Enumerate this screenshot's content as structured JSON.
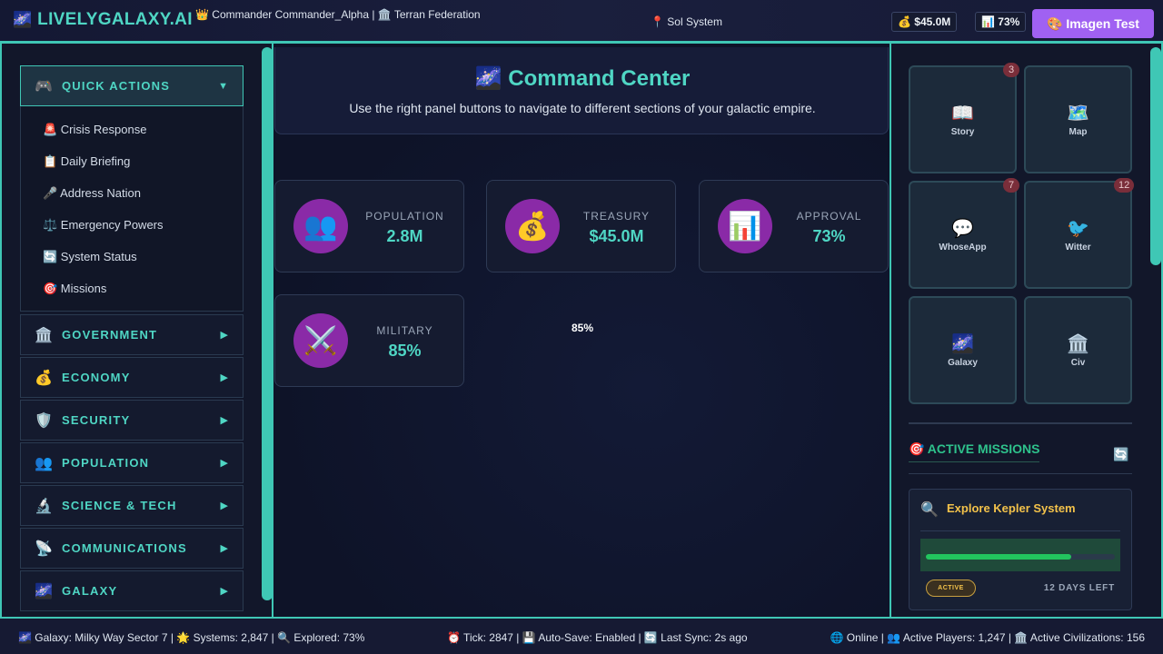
{
  "header": {
    "logo_icon": "🌌",
    "logo_text": "LIVELYGALAXY.AI",
    "commander": "👑 Commander Commander_Alpha | 🏛️ Terran Federation",
    "location": "📍 Sol System",
    "treasury_chip": "💰 $45.0M",
    "approval_chip": "📊 73%",
    "imagen_button": "🎨 Imagen Test"
  },
  "sidebar": {
    "quick_actions": {
      "icon": "🎮",
      "label": "QUICK ACTIONS",
      "caret": "▼",
      "items": [
        {
          "label": "🚨 Crisis Response"
        },
        {
          "label": "📋 Daily Briefing"
        },
        {
          "label": "🎤 Address Nation"
        },
        {
          "label": "⚖️ Emergency Powers"
        },
        {
          "label": "🔄 System Status"
        },
        {
          "label": "🎯 Missions"
        }
      ]
    },
    "sections": [
      {
        "icon": "🏛️",
        "label": "GOVERNMENT",
        "caret": "▶"
      },
      {
        "icon": "💰",
        "label": "ECONOMY",
        "caret": "▶"
      },
      {
        "icon": "🛡️",
        "label": "SECURITY",
        "caret": "▶"
      },
      {
        "icon": "👥",
        "label": "POPULATION",
        "caret": "▶"
      },
      {
        "icon": "🔬",
        "label": "SCIENCE & TECH",
        "caret": "▶"
      },
      {
        "icon": "📡",
        "label": "COMMUNICATIONS",
        "caret": "▶"
      },
      {
        "icon": "🌌",
        "label": "GALAXY",
        "caret": "▶"
      }
    ]
  },
  "command_center": {
    "title": "🌌 Command Center",
    "subtitle": "Use the right panel buttons to navigate to different sections of your galactic empire."
  },
  "stats": [
    {
      "icon": "👥",
      "label": "POPULATION",
      "value": "2.8M"
    },
    {
      "icon": "💰",
      "label": "TREASURY",
      "value": "$45.0M"
    },
    {
      "icon": "📊",
      "label": "APPROVAL",
      "value": "73%"
    },
    {
      "icon": "⚔️",
      "label": "MILITARY",
      "value": "85%"
    }
  ],
  "floating_value": "85%",
  "apps": [
    {
      "icon": "📖",
      "label": "Story",
      "badge": "3"
    },
    {
      "icon": "🗺️",
      "label": "Map",
      "badge": ""
    },
    {
      "icon": "💬",
      "label": "WhoseApp",
      "badge": "7"
    },
    {
      "icon": "🐦",
      "label": "Witter",
      "badge": "12"
    },
    {
      "icon": "🌌",
      "label": "Galaxy",
      "badge": ""
    },
    {
      "icon": "🏛️",
      "label": "Civ",
      "badge": ""
    }
  ],
  "missions": {
    "title": "🎯 ACTIVE MISSIONS",
    "refresh_icon": "🔄",
    "items": [
      {
        "icon": "🔍",
        "name": "Explore Kepler System",
        "progress": 0.77,
        "status": "ACTIVE",
        "days_left": "12 DAYS LEFT"
      }
    ]
  },
  "footer": {
    "left": "🌌 Galaxy: Milky Way Sector 7 | 🌟 Systems: 2,847 | 🔍 Explored: 73%",
    "mid": "⏰ Tick: 2847 | 💾 Auto-Save: Enabled | 🔄 Last Sync: 2s ago",
    "right": "🌐 Online | 👥 Active Players: 1,247 | 🏛️ Active Civilizations: 156"
  },
  "colors": {
    "accent": "#3fc7b5",
    "accent_text": "#4fd6c4",
    "stat_icon_bg": "#8a2aa7",
    "imagen_button": "#a061f2",
    "mission_title": "#f3c24a",
    "progress_fill": "#22c55e"
  }
}
